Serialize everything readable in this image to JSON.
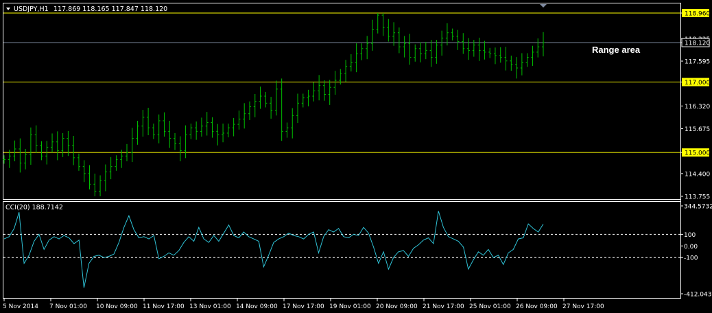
{
  "header": {
    "symbol": "USDJPY,H1",
    "ohlc": "117.869 118.165 117.847 118.120"
  },
  "indicator": {
    "label": "CCI(20) 188.7142"
  },
  "annotation": {
    "text": "Range area"
  },
  "colors": {
    "background": "#000000",
    "candle": "#00c000",
    "cci_line": "#2fc2d6",
    "level_line": "#ffff00",
    "current_price_line": "#7e8aa0",
    "level_tag": "#ffff00"
  },
  "chart_data": [
    {
      "type": "bar",
      "title": "USDJPY,H1",
      "ylim": [
        113.755,
        118.96
      ],
      "price_axis_ticks": [
        "118.960",
        "118.225",
        "118.120",
        "117.595",
        "117.000",
        "116.320",
        "115.675",
        "115.000",
        "114.400",
        "113.755"
      ],
      "highlighted_levels": [
        {
          "label": "118.960",
          "value": 118.96
        },
        {
          "label": "117.000",
          "value": 117.0
        },
        {
          "label": "115.000",
          "value": 115.0
        }
      ],
      "current_price": {
        "label": "118.120",
        "value": 118.12
      },
      "x_tick_labels": [
        "5 Nov 2014",
        "7 Nov 01:00",
        "10 Nov 09:00",
        "11 Nov 17:00",
        "13 Nov 01:00",
        "14 Nov 09:00",
        "17 Nov 17:00",
        "19 Nov 01:00",
        "20 Nov 09:00",
        "21 Nov 17:00",
        "25 Nov 01:00",
        "26 Nov 09:00",
        "27 Nov 17:00"
      ],
      "series": [
        {
          "values": [
            114.8,
            114.9,
            115.1,
            114.7,
            114.95,
            115.5,
            115.2,
            114.9,
            115.15,
            115.3,
            115.05,
            115.4,
            115.2,
            114.85,
            114.6,
            114.4,
            114.1,
            113.9,
            114.2,
            114.45,
            114.6,
            114.8,
            114.9,
            115.0,
            115.4,
            115.75,
            116.0,
            115.7,
            115.5,
            115.9,
            115.6,
            115.4,
            115.25,
            115.05,
            115.5,
            115.7,
            115.6,
            115.75,
            115.85,
            115.6,
            115.5,
            115.55,
            115.7,
            115.8,
            115.95,
            116.1,
            116.3,
            116.45,
            116.6,
            116.4,
            116.2,
            116.8,
            115.6,
            115.7,
            116.05,
            116.4,
            116.55,
            116.6,
            116.75,
            116.9,
            116.65,
            116.85,
            117.05,
            117.25,
            117.45,
            117.55,
            117.8,
            117.95,
            118.1,
            118.5,
            118.9,
            118.55,
            118.3,
            118.4,
            118.0,
            118.1,
            117.7,
            117.95,
            117.8,
            117.9,
            117.7,
            118.05,
            118.25,
            118.4,
            118.3,
            118.15,
            117.95,
            117.9,
            118.05,
            117.9,
            117.85,
            117.8,
            117.75,
            117.7,
            117.6,
            117.5,
            117.4,
            117.55,
            117.7,
            117.85,
            118.0,
            118.12
          ]
        }
      ]
    },
    {
      "type": "line",
      "title": "CCI(20) 188.7142",
      "ylim": [
        -412.0435,
        344.5732
      ],
      "y_tick_labels": [
        "344.5732",
        "100",
        "0.00",
        "-100",
        "-412.0435"
      ],
      "levels": [
        100,
        -100
      ],
      "series": [
        {
          "values": [
            60,
            80,
            150,
            290,
            -150,
            -80,
            40,
            100,
            -30,
            50,
            80,
            60,
            90,
            70,
            20,
            50,
            -360,
            -150,
            -90,
            -80,
            -100,
            -90,
            -70,
            30,
            160,
            260,
            140,
            70,
            80,
            60,
            90,
            -110,
            -90,
            -60,
            -80,
            -40,
            30,
            80,
            40,
            160,
            60,
            30,
            90,
            40,
            110,
            180,
            90,
            70,
            120,
            80,
            60,
            40,
            -180,
            -80,
            30,
            60,
            80,
            110,
            90,
            80,
            60,
            100,
            120,
            -60,
            80,
            140,
            120,
            150,
            80,
            70,
            100,
            90,
            160,
            110,
            -10,
            -150,
            -50,
            -200,
            -100,
            -50,
            -40,
            -90,
            -20,
            10,
            50,
            70,
            20,
            300,
            160,
            80,
            60,
            40,
            -10,
            -200,
            -120,
            -50,
            -80,
            -30,
            -100,
            -80,
            -160,
            -60,
            -30,
            60,
            70,
            190,
            150,
            120,
            188.71
          ]
        }
      ]
    }
  ]
}
